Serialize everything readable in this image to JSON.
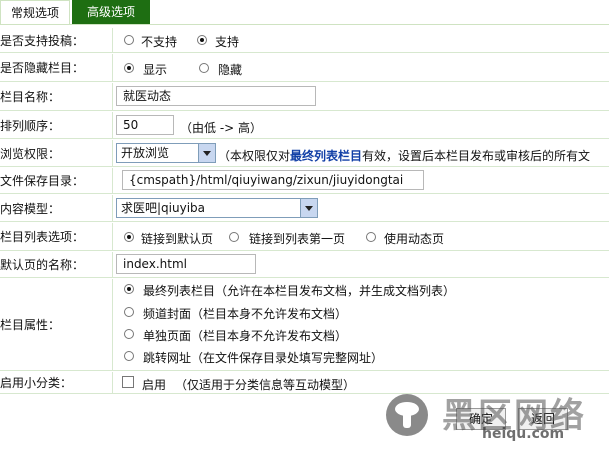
{
  "tabs": {
    "normal": "常规选项",
    "advanced": "高级选项"
  },
  "rows": {
    "allow_submit": {
      "label": "是否支持投稿：",
      "opt1": "不支持",
      "opt2": "支持"
    },
    "hide_column": {
      "label": "是否隐藏栏目：",
      "opt1": "显示",
      "opt2": "隐藏"
    },
    "column_name": {
      "label": "栏目名称：",
      "value": "就医动态"
    },
    "order": {
      "label": "排列顺序：",
      "value": "50",
      "hint": "（由低 -> 高）"
    },
    "permission": {
      "label": "浏览权限：",
      "selected": "开放浏览",
      "note_before": "（本权限仅对",
      "note_bold": "最终列表栏目",
      "note_after": "有效，设置后本栏目发布或审核后的所有文"
    },
    "save_dir": {
      "label": "文件保存目录：",
      "value": "{cmspath}/html/qiuyiwang/zixun/jiuyidongtai"
    },
    "content_model": {
      "label": "内容模型：",
      "selected": "求医吧|qiuyiba"
    },
    "list_option": {
      "label": "栏目列表选项：",
      "opt1": "链接到默认页",
      "opt2": "链接到列表第一页",
      "opt3": "使用动态页"
    },
    "default_page": {
      "label": "默认页的名称：",
      "value": "index.html"
    },
    "attribute": {
      "label": "栏目属性：",
      "opt1": "最终列表栏目（允许在本栏目发布文档，并生成文档列表）",
      "opt2": "频道封面（栏目本身不允许发布文档）",
      "opt3": "单独页面（栏目本身不允许发布文档）",
      "opt4": "跳转网址（在文件保存目录处填写完整网址）"
    },
    "subclass": {
      "label": "启用小分类：",
      "check_label": "启用",
      "hint": "（仅适用于分类信息等互动模型）"
    }
  },
  "buttons": {
    "ok": "确定",
    "back": "返回"
  },
  "watermark": {
    "cn": "黑区网络",
    "url": "heiqu.com"
  }
}
